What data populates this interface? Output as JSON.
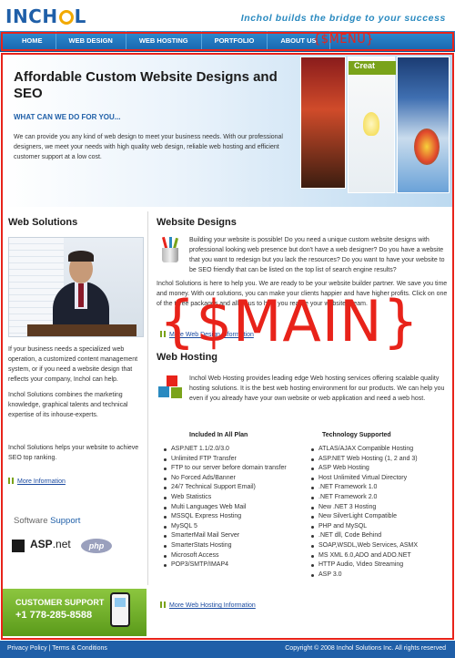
{
  "header": {
    "logo_text_left": "INCH",
    "logo_text_right": "L",
    "tagline": "Inchol builds the bridge to your success"
  },
  "nav": {
    "items": [
      {
        "label": "HOME"
      },
      {
        "label": "WEB DESIGN"
      },
      {
        "label": "WEB HOSTING"
      },
      {
        "label": "PORTFOLIO"
      },
      {
        "label": "ABOUT US"
      }
    ],
    "placeholder_tag": "{$MENU}"
  },
  "main_placeholder_tag": "{$MAIN}",
  "hero": {
    "title": "Affordable Custom Website Designs and SEO",
    "subtitle": "WHAT CAN WE DO FOR YOU...",
    "text": "We can provide you any kind of web design to meet your business needs. With our professional designers, we meet your needs with high quality web design, reliable web hosting and efficient customer support at a low cost.",
    "collage_label": "Creat"
  },
  "left": {
    "title": "Web Solutions",
    "p1": "If your business needs a specialized web operation, a customized content management system, or if you need a website design that reflects your company, Inchol can help.",
    "p2": "Inchol Solutions combines the marketing knowledge, graphical talents and technical expertise of its inhouse-experts.",
    "p3": "Inchol Solutions helps your website to achieve SEO top ranking.",
    "more_link": "More Information",
    "software_support_a": "Software",
    "software_support_b": "Support",
    "logo_asp": "ASP",
    "logo_asp_suffix": ".net",
    "logo_php": "php",
    "support_box": {
      "title": "CUSTOMER SUPPORT",
      "phone": "+1 778-285-8588"
    }
  },
  "designs": {
    "title": "Website Designs",
    "p1": "Building your website is possible! Do you need a unique custom website designs with professional looking web presence but don't have a web designer? Do you have a website that you want to redesign but you lack the resources? Do you want to have your website to be SEO friendly that can be listed on the top list of search engine results?",
    "p2": "Inchol Solutions is here to help you. We are ready to be your website builder partner. We save you time and money. With our solutions, you can make your clients happier and have higher profits. Click on one of the three packages and allow us to help you realize your website dream.",
    "more_link": "More Web Design Information"
  },
  "hosting": {
    "title": "Web Hosting",
    "p1": "Inchol Web Hosting provides leading edge Web hosting services offering scalable quality hosting solutions. It is the best web hosting environment for our products. We can help you even if you already have your own website or web application and need a web host.",
    "included_title": "Included In All Plan",
    "included": [
      "ASP.NET 1.1/2.0/3.0",
      "Unlimited FTP Transfer",
      "FTP to our server before domain transfer",
      "No Forced Ads/Banner",
      "24/7 Technical Support Email)",
      "Web Statistics",
      "Multi Languages Web Mail",
      "MSSQL Express Hosting",
      "MySQL 5",
      "SmarterMail Mail Server",
      "SmarterStats Hosting",
      "Microsoft Access",
      "POP3/SMTP/IMAP4"
    ],
    "tech_title": "Technology Supported",
    "tech": [
      "ATLAS/AJAX Compatible Hosting",
      "ASP.NET Web Hosting (1, 2 and 3)",
      "ASP Web Hosting",
      "Host Unlimited Virtual Directory",
      ".NET Framework 1.0",
      ".NET Framework 2.0",
      "New .NET 3 Hosting",
      "New SilverLight Compatible",
      "PHP and MySQL",
      ".NET dll, Code Behind",
      "SOAP,WSDL,Web Services, ASMX",
      "MS XML 6.0,ADO and ADO.NET",
      "HTTP Audio, Video Streaming",
      "ASP 3.0"
    ],
    "more_link": "More Web Hosting Information"
  },
  "footer": {
    "privacy": "Privacy Policy",
    "separator": "|",
    "terms": "Terms & Conditions",
    "copyright": "Copyright © 2008 Inchol Solutions Inc. All rights reserved"
  }
}
